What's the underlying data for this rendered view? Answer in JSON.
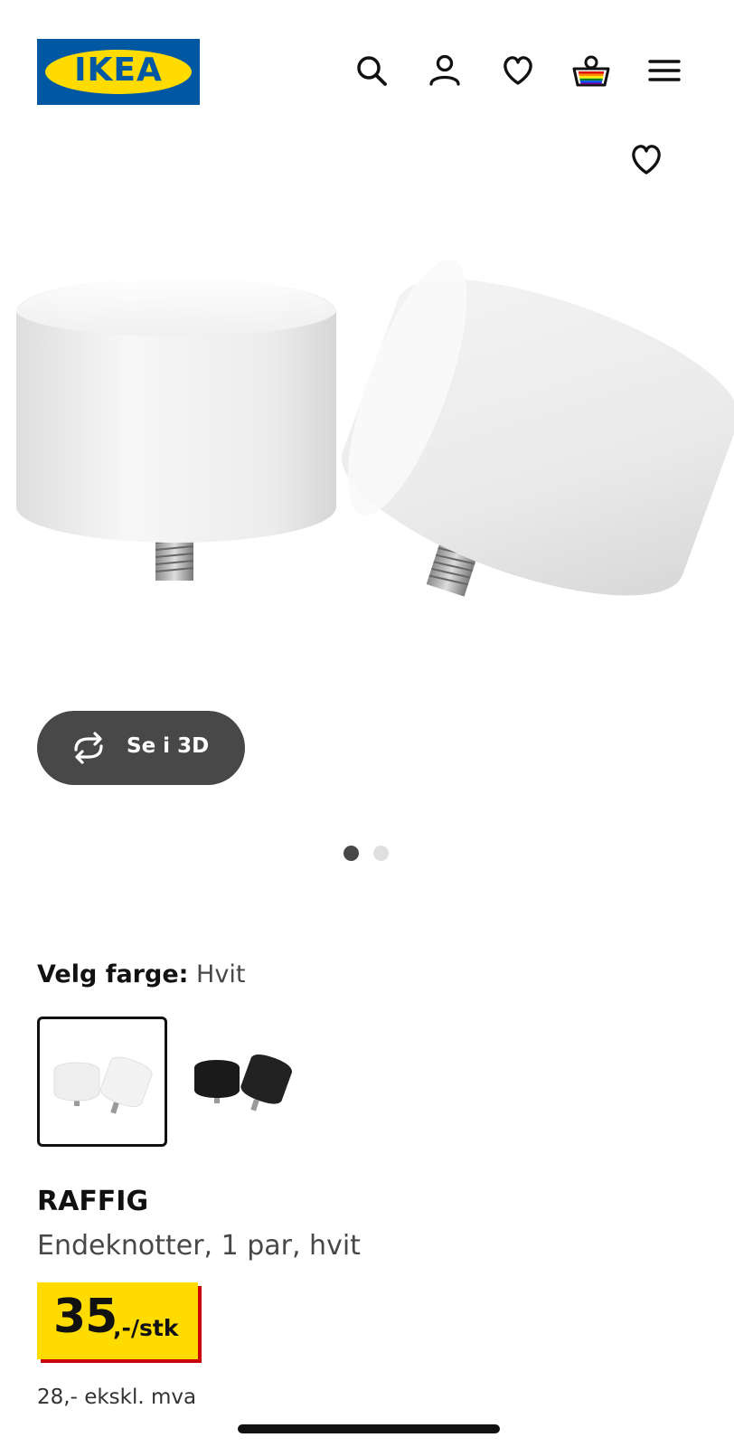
{
  "header": {
    "logo_text": "IKEA",
    "logo_registered": "®",
    "icons": [
      "search-icon",
      "account-icon",
      "favourites-icon",
      "cart-icon",
      "menu-icon"
    ]
  },
  "product_image": {
    "favourite_icon": "heart-icon",
    "view_3d_label": "Se i 3D",
    "view_3d_icon": "rotate-3d-icon",
    "carousel": {
      "total": 2,
      "active": 1
    }
  },
  "color_selector": {
    "label": "Velg farge:",
    "selected_value": "Hvit",
    "options": [
      {
        "color": "#ffffff",
        "selected": true
      },
      {
        "color": "#1a1a1a",
        "selected": false
      }
    ]
  },
  "product": {
    "name": "RAFFIG",
    "description": "Endeknotter, 1 par, hvit",
    "price_integer": "35",
    "price_suffix": ",-/stk",
    "price_ex_vat": "28,- ekskl. mva"
  },
  "colors": {
    "ikea_blue": "#0058a3",
    "ikea_yellow": "#ffdb00",
    "price_red": "#cc0008",
    "button_dark": "#484848"
  }
}
